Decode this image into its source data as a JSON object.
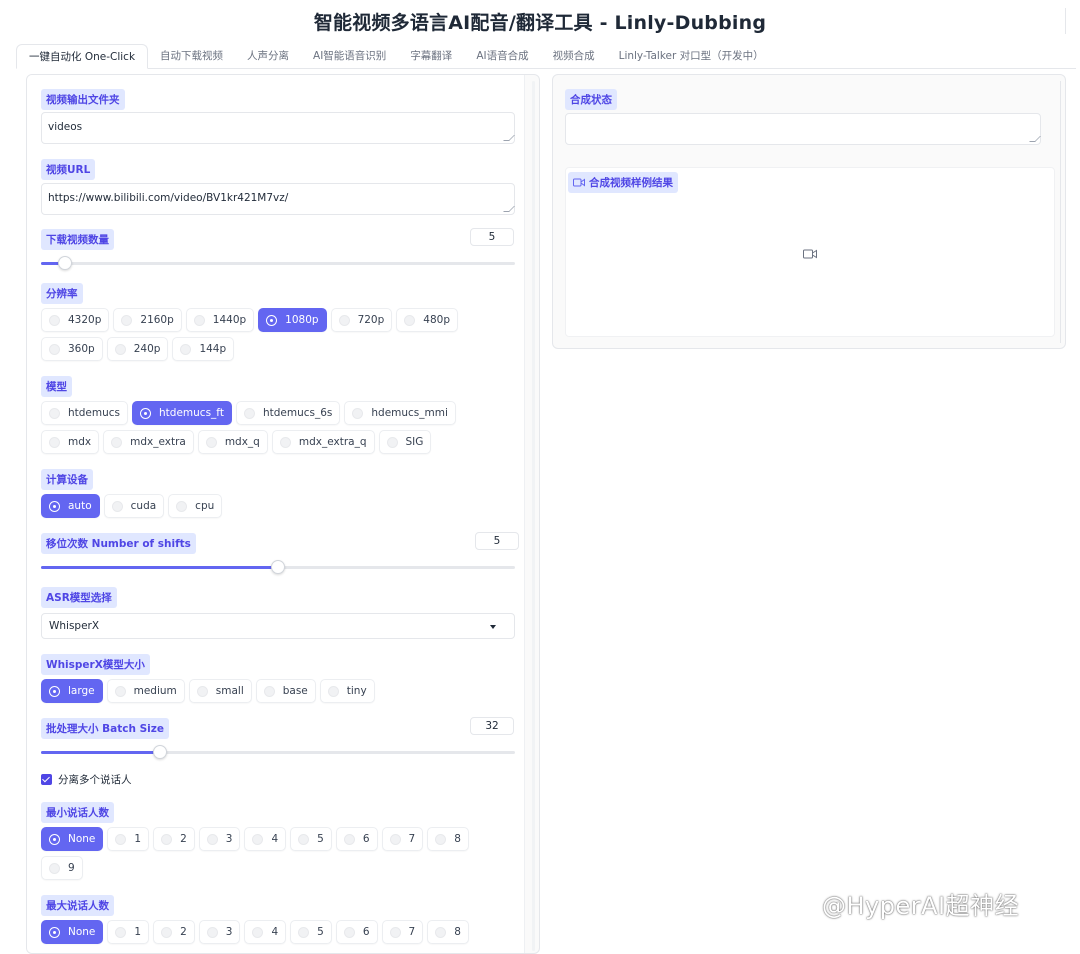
{
  "app": {
    "title": "智能视频多语言AI配音/翻译工具 - Linly-Dubbing"
  },
  "tabs": [
    {
      "label": "一键自动化 One-Click",
      "selected": true
    },
    {
      "label": "自动下载视频"
    },
    {
      "label": "人声分离"
    },
    {
      "label": "AI智能语音识别"
    },
    {
      "label": "字幕翻译"
    },
    {
      "label": "AI语音合成"
    },
    {
      "label": "视频合成"
    },
    {
      "label": "Linly-Talker 对口型（开发中）"
    }
  ],
  "form": {
    "output_folder": {
      "label": "视频输出文件夹",
      "value": "videos"
    },
    "video_url": {
      "label": "视频URL",
      "value": "https://www.bilibili.com/video/BV1kr421M7vz/"
    },
    "download_count": {
      "label": "下载视频数量",
      "value": "5",
      "fraction": 0.05
    },
    "resolution": {
      "label": "分辨率",
      "options": [
        "4320p",
        "2160p",
        "1440p",
        "1080p",
        "720p",
        "480p",
        "360p",
        "240p",
        "144p"
      ],
      "selected": "1080p"
    },
    "model": {
      "label": "模型",
      "options": [
        "htdemucs",
        "htdemucs_ft",
        "htdemucs_6s",
        "hdemucs_mmi",
        "mdx",
        "mdx_extra",
        "mdx_q",
        "mdx_extra_q",
        "SIG"
      ],
      "selected": "htdemucs_ft"
    },
    "device": {
      "label": "计算设备",
      "options": [
        "auto",
        "cuda",
        "cpu"
      ],
      "selected": "auto"
    },
    "shifts": {
      "label": "移位次数 Number of shifts",
      "value": "5",
      "fraction": 0.5
    },
    "asr_model": {
      "label": "ASR模型选择",
      "value": "WhisperX"
    },
    "whisperx_size": {
      "label": "WhisperX模型大小",
      "options": [
        "large",
        "medium",
        "small",
        "base",
        "tiny"
      ],
      "selected": "large"
    },
    "batch_size": {
      "label": "批处理大小 Batch Size",
      "value": "32",
      "fraction": 0.25
    },
    "diarization": {
      "label": "分离多个说话人",
      "checked": true
    },
    "min_speakers": {
      "label": "最小说话人数",
      "options": [
        "None",
        "1",
        "2",
        "3",
        "4",
        "5",
        "6",
        "7",
        "8",
        "9"
      ],
      "selected": "None"
    },
    "max_speakers": {
      "label": "最大说话人数",
      "options": [
        "None",
        "1",
        "2",
        "3",
        "4",
        "5",
        "6",
        "7",
        "8"
      ],
      "selected": "None"
    }
  },
  "output": {
    "status_label": "合成状态",
    "status_value": "",
    "video_label": "合成视频样例结果"
  },
  "watermark": "@HyperAI超神经",
  "colors": {
    "accent": "#6366f1",
    "label_bg": "#e0e7ff",
    "label_text": "#4f46e5"
  }
}
